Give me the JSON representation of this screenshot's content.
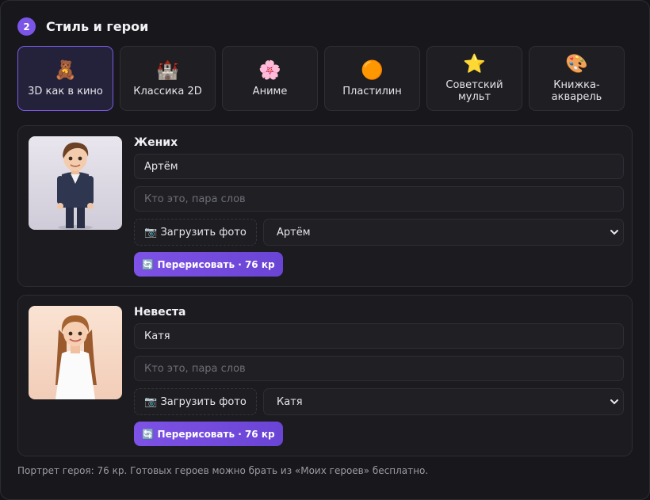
{
  "section": {
    "step": "2",
    "title": "Стиль и герои"
  },
  "styles": [
    {
      "emoji": "🧸",
      "label": "3D как в кино",
      "active": true
    },
    {
      "emoji": "🏰",
      "label": "Классика 2D",
      "active": false
    },
    {
      "emoji": "🌸",
      "label": "Аниме",
      "active": false
    },
    {
      "emoji": "🟠",
      "label": "Пластилин",
      "active": false
    },
    {
      "emoji": "⭐",
      "label": "Советский мульт",
      "active": false
    },
    {
      "emoji": "🎨",
      "label": "Книжка-акварель",
      "active": false
    }
  ],
  "heroes": [
    {
      "role": "Жених",
      "name_value": "Артём",
      "description_placeholder": "Кто это, пара слов",
      "upload_label": "📷 Загрузить фото",
      "select_value": "Артём",
      "redraw_label": "🔄 Перерисовать · 76 кр"
    },
    {
      "role": "Невеста",
      "name_value": "Катя",
      "description_placeholder": "Кто это, пара слов",
      "upload_label": "📷 Загрузить фото",
      "select_value": "Катя",
      "redraw_label": "🔄 Перерисовать · 76 кр"
    }
  ],
  "footnote": "Портрет героя: 76 кр. Готовых героев можно брать из «Моих героев» бесплатно."
}
